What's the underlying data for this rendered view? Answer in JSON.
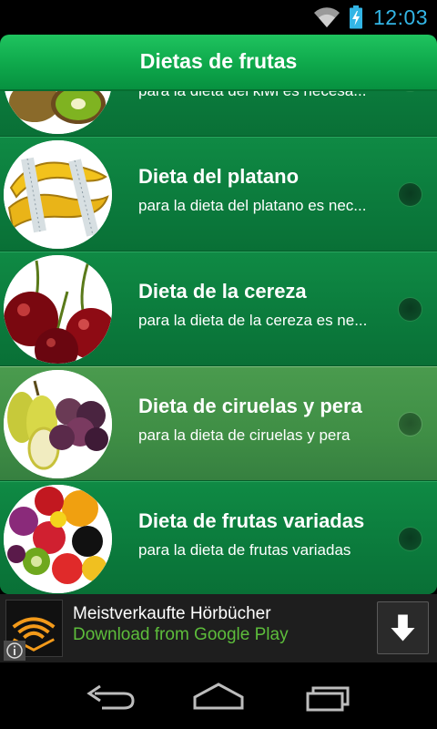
{
  "status_bar": {
    "time": "12:03",
    "wifi_icon": "wifi-icon",
    "battery_icon": "battery-charging-icon",
    "accent": "#33b5e5"
  },
  "header": {
    "title": "Dietas de frutas"
  },
  "list": {
    "items": [
      {
        "title": "",
        "subtitle": "para la dieta del kiwi es necesa...",
        "image": "kiwi-image",
        "selected": false
      },
      {
        "title": "Dieta del platano",
        "subtitle": "para la dieta del platano es nec...",
        "image": "banana-image",
        "selected": false
      },
      {
        "title": "Dieta de la cereza",
        "subtitle": "para la dieta de la cereza es ne...",
        "image": "cherry-image",
        "selected": false
      },
      {
        "title": "Dieta de ciruelas y pera",
        "subtitle": "para la dieta de ciruelas y pera",
        "image": "plum-pear-image",
        "selected": true
      },
      {
        "title": "Dieta de frutas variadas",
        "subtitle": "para la dieta de frutas variadas",
        "image": "mixed-fruit-image",
        "selected": false
      }
    ]
  },
  "ad": {
    "title": "Meistverkaufte Hörbücher",
    "subtitle": "Download from Google Play",
    "icon": "audible-icon",
    "button_icon": "download-arrow-icon",
    "info_icon": "info-icon",
    "subtitle_color": "#5dbd3b"
  },
  "nav": {
    "back_icon": "back-icon",
    "home_icon": "home-icon",
    "recents_icon": "recents-icon"
  },
  "colors": {
    "header": "#0ea84b",
    "row": "#0b7a3c",
    "selected_row": "#3f8e45"
  }
}
